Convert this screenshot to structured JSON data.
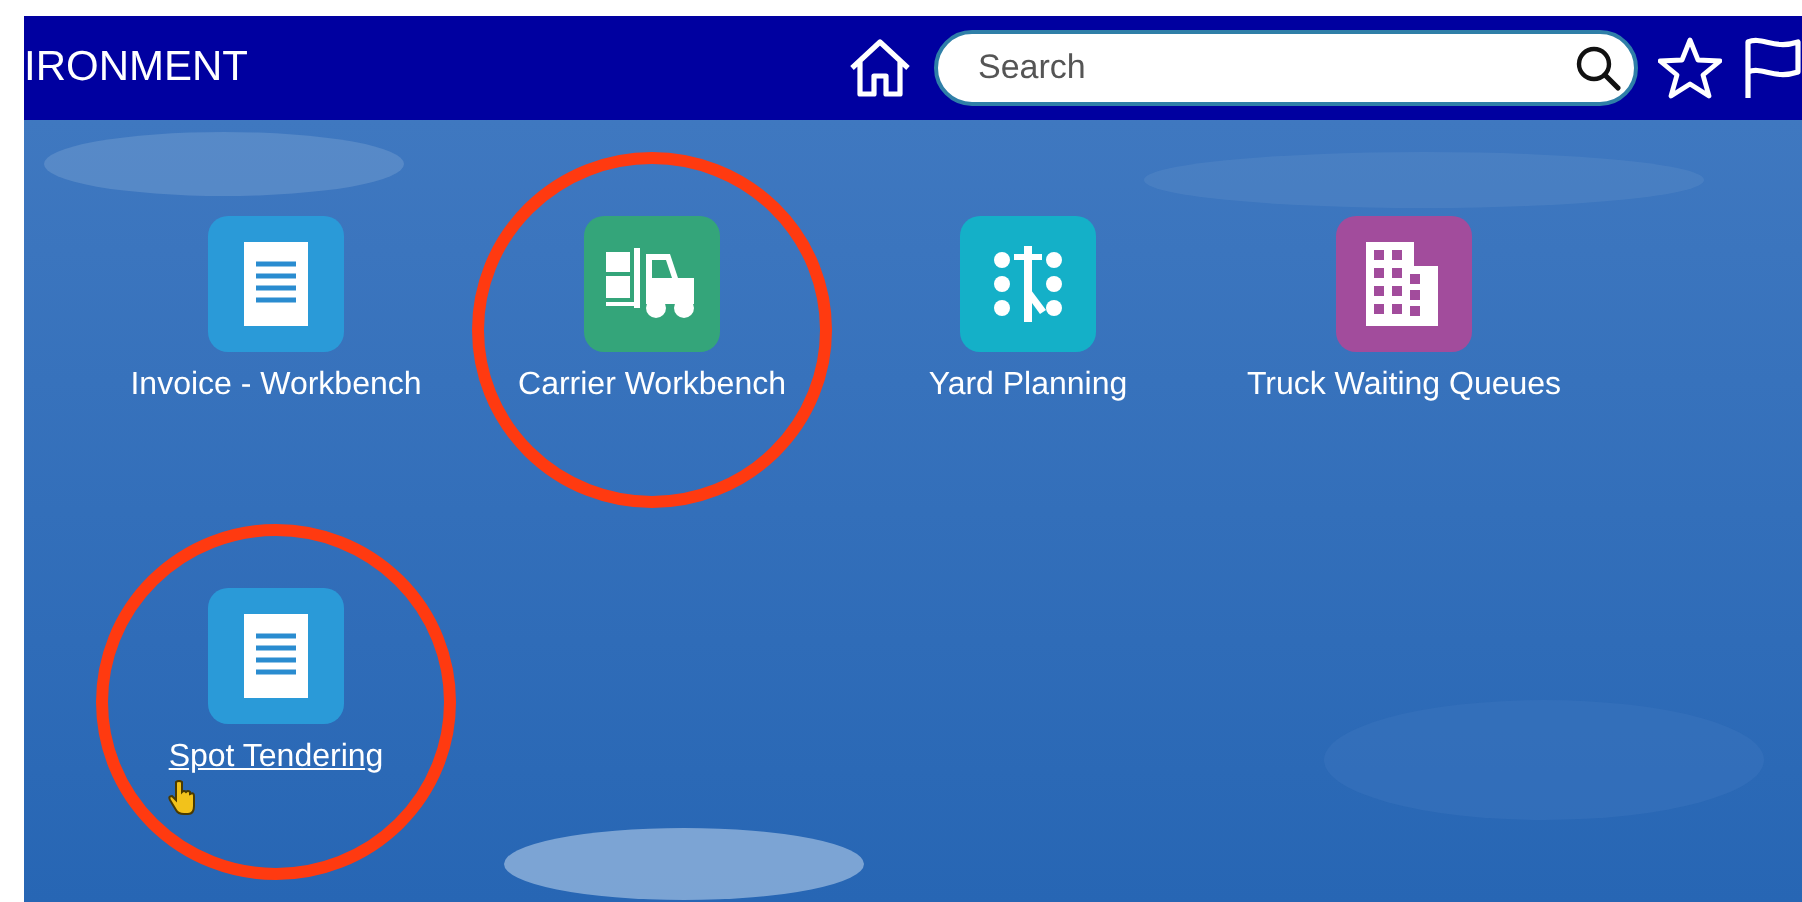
{
  "header": {
    "title": "IRONMENT",
    "search": {
      "placeholder": "Search"
    }
  },
  "tiles": [
    {
      "label": "Invoice - Workbench",
      "kind": "document",
      "color": "#2a9ad8",
      "circled": false,
      "hovered": false
    },
    {
      "label": "Carrier Workbench",
      "kind": "forklift",
      "color": "#34a57a",
      "circled": true,
      "hovered": false
    },
    {
      "label": "Yard Planning",
      "kind": "dots",
      "color": "#14b0c8",
      "circled": false,
      "hovered": false
    },
    {
      "label": "Truck Waiting Queues",
      "kind": "building",
      "color": "#a24c9c",
      "circled": false,
      "hovered": false
    },
    {
      "label": "Spot Tendering",
      "kind": "document",
      "color": "#2a9ad8",
      "circled": true,
      "hovered": true
    }
  ]
}
